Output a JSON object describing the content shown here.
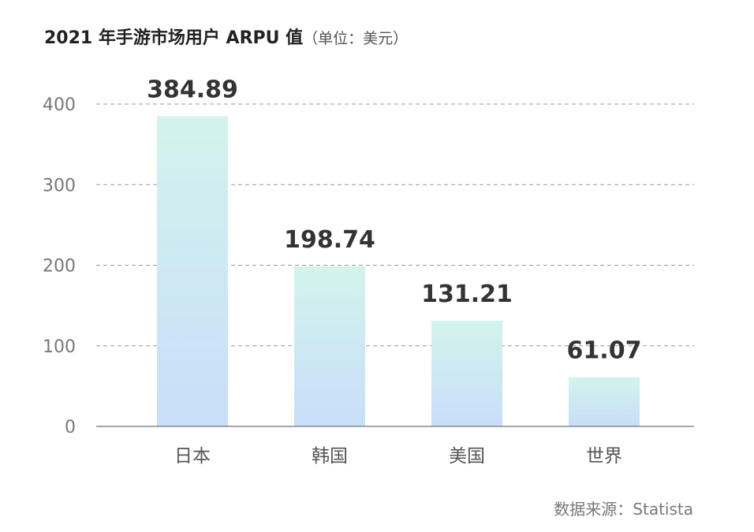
{
  "chart_data": {
    "type": "bar",
    "title": "2021 年手游市场用户 ARPU 值",
    "unit_label": "（单位：美元）",
    "categories": [
      "日本",
      "韩国",
      "美国",
      "世界"
    ],
    "values": [
      384.89,
      198.74,
      131.21,
      61.07
    ],
    "value_labels": [
      "384.89",
      "198.74",
      "131.21",
      "61.07"
    ],
    "yticks": [
      0,
      100,
      200,
      300,
      400
    ],
    "ylim": [
      0,
      400
    ],
    "grid": true,
    "gradient_top": "#d3f3ec",
    "gradient_bottom": "#c8def9"
  },
  "source": "数据来源：Statista"
}
